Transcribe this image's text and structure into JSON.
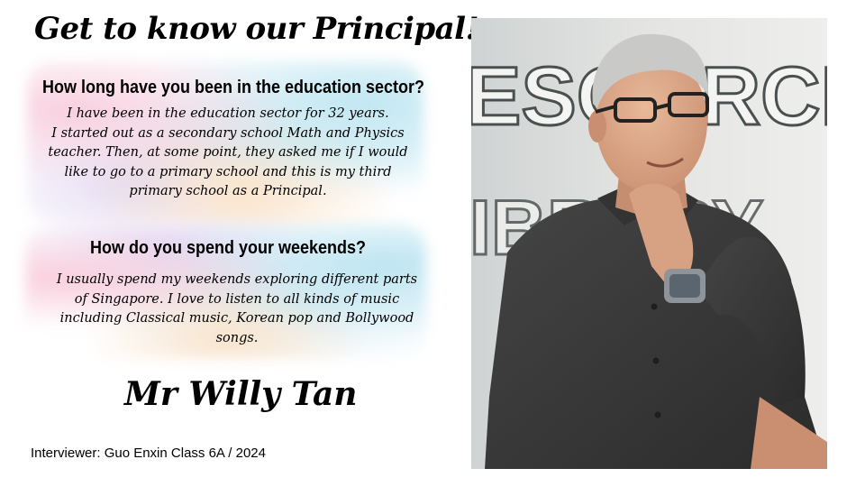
{
  "title": "Get to know our Principal!",
  "question1": "How long have you been in the education sector?",
  "answer1": [
    "I have been in the education sector for 32 years.",
    "I started out as a secondary school Math and Physics",
    "teacher. Then, at some point, they asked me if I would",
    "like to go to a primary school and this is my third",
    "primary school as a Principal."
  ],
  "question2": "How do you spend your weekends?",
  "answer2": [
    "I usually spend my weekends exploring different parts",
    "of Singapore. I love to listen to all kinds of music",
    "including Classical music, Korean pop and Bollywood",
    "songs."
  ],
  "name": "Mr Willy Tan",
  "interviewer": "Interviewer:  Guo Enxin Class 6A / 2024",
  "photo": {
    "wall_sign": [
      "ESOURCE",
      "IBRARY"
    ]
  },
  "colors": {
    "watercolor_pink": "#f2a7c3",
    "watercolor_blue": "#8fd3e8",
    "watercolor_peach": "#f8d2a4",
    "shirt": "#3a3a3a"
  }
}
